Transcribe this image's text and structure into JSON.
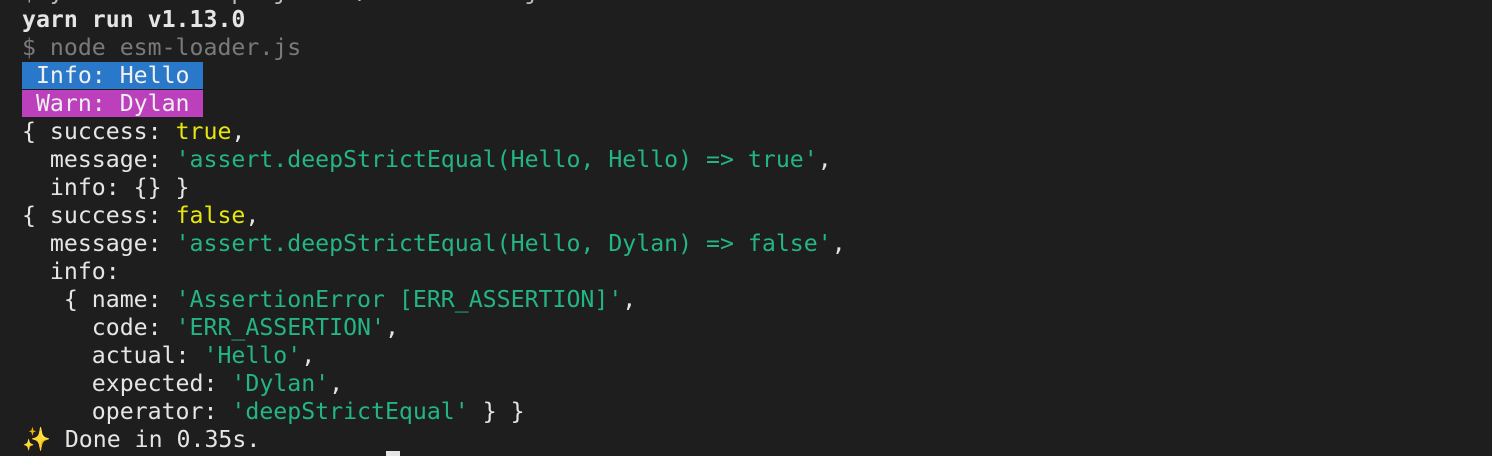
{
  "terminal": {
    "lines": [
      [
        {
          "text": "$ yarn start --project=./esm-loader.js",
          "cls": "partial"
        }
      ],
      [
        {
          "text": "yarn run v1.13.0",
          "cls": "bold"
        }
      ],
      [
        {
          "text": "$ node esm-loader.js",
          "cls": "dim"
        }
      ],
      [
        {
          "text": " Info: Hello ",
          "cls": "info"
        }
      ],
      [
        {
          "text": " Warn: Dylan ",
          "cls": "warn"
        }
      ],
      [
        {
          "text": "{ success: ",
          "cls": ""
        },
        {
          "text": "true",
          "cls": "yellow"
        },
        {
          "text": ",",
          "cls": ""
        }
      ],
      [
        {
          "text": "  message: ",
          "cls": ""
        },
        {
          "text": "'assert.deepStrictEqual(Hello, Hello) => true'",
          "cls": "green"
        },
        {
          "text": ",",
          "cls": ""
        }
      ],
      [
        {
          "text": "  info: {} }",
          "cls": ""
        }
      ],
      [
        {
          "text": "{ success: ",
          "cls": ""
        },
        {
          "text": "false",
          "cls": "yellow"
        },
        {
          "text": ",",
          "cls": ""
        }
      ],
      [
        {
          "text": "  message: ",
          "cls": ""
        },
        {
          "text": "'assert.deepStrictEqual(Hello, Dylan) => false'",
          "cls": "green"
        },
        {
          "text": ",",
          "cls": ""
        }
      ],
      [
        {
          "text": "  info:",
          "cls": ""
        }
      ],
      [
        {
          "text": "   { name: ",
          "cls": ""
        },
        {
          "text": "'AssertionError [ERR_ASSERTION]'",
          "cls": "green"
        },
        {
          "text": ",",
          "cls": ""
        }
      ],
      [
        {
          "text": "     code: ",
          "cls": ""
        },
        {
          "text": "'ERR_ASSERTION'",
          "cls": "green"
        },
        {
          "text": ",",
          "cls": ""
        }
      ],
      [
        {
          "text": "     actual: ",
          "cls": ""
        },
        {
          "text": "'Hello'",
          "cls": "green"
        },
        {
          "text": ",",
          "cls": ""
        }
      ],
      [
        {
          "text": "     expected: ",
          "cls": ""
        },
        {
          "text": "'Dylan'",
          "cls": "green"
        },
        {
          "text": ",",
          "cls": ""
        }
      ],
      [
        {
          "text": "     operator: ",
          "cls": ""
        },
        {
          "text": "'deepStrictEqual'",
          "cls": "green"
        },
        {
          "text": " } }",
          "cls": ""
        }
      ],
      [
        {
          "text": "✨ ",
          "cls": ""
        },
        {
          "text": "Done in 0.35s.",
          "cls": ""
        }
      ]
    ]
  },
  "colors": {
    "info_bg": "#2a78c9",
    "warn_bg": "#bc3fbc",
    "string": "#23b584",
    "boolean": "#e5e510",
    "background": "#1e1e1e"
  }
}
